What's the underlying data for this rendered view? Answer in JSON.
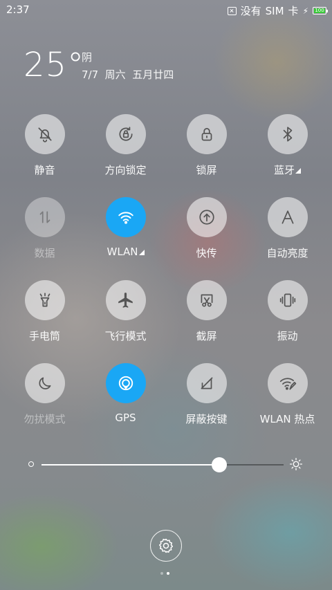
{
  "status_bar": {
    "time": "2:37",
    "carrier_1": "没有",
    "carrier_2": "SIM",
    "carrier_3": "卡",
    "battery_level": "100",
    "battery_color": "#3ccb3c"
  },
  "weather": {
    "temperature": "25°",
    "condition": "阴",
    "date_line": "7/7  周六  五月廿四"
  },
  "toggles": [
    {
      "label": "静音",
      "icon": "bell-off-icon",
      "state": "off"
    },
    {
      "label": "方向锁定",
      "icon": "rotation-lock-icon",
      "state": "off"
    },
    {
      "label": "锁屏",
      "icon": "lock-icon",
      "state": "off"
    },
    {
      "label": "蓝牙",
      "icon": "bluetooth-icon",
      "state": "off"
    },
    {
      "label": "数据",
      "icon": "mobile-data-icon",
      "state": "disabled"
    },
    {
      "label": "WLAN",
      "icon": "wifi-icon",
      "state": "on"
    },
    {
      "label": "快传",
      "icon": "upload-icon",
      "state": "off"
    },
    {
      "label": "自动亮度",
      "icon": "auto-brightness-icon",
      "state": "off"
    },
    {
      "label": "手电筒",
      "icon": "flashlight-icon",
      "state": "off"
    },
    {
      "label": "飞行模式",
      "icon": "airplane-icon",
      "state": "off"
    },
    {
      "label": "截屏",
      "icon": "screenshot-icon",
      "state": "off"
    },
    {
      "label": "振动",
      "icon": "vibrate-icon",
      "state": "off"
    },
    {
      "label": "勿扰模式",
      "icon": "moon-icon",
      "state": "off"
    },
    {
      "label": "GPS",
      "icon": "gps-icon",
      "state": "on"
    },
    {
      "label": "屏蔽按键",
      "icon": "block-keys-icon",
      "state": "off"
    },
    {
      "label": "WLAN 热点",
      "icon": "hotspot-icon",
      "state": "off"
    }
  ],
  "brightness": {
    "level_fraction": 0.735
  },
  "colors": {
    "active_toggle": "#1aa7f5"
  },
  "pager": {
    "pages": 2,
    "current": 2
  }
}
